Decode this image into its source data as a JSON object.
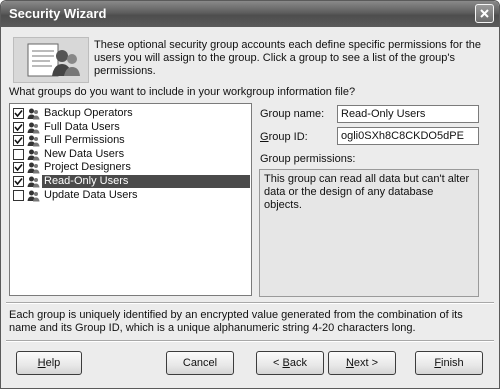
{
  "window": {
    "title": "Security Wizard"
  },
  "intro_text": "These optional security group accounts each define specific permissions for the users you will assign to the group. Click a group to see a list of the group's permissions.",
  "question": "What groups do you want to include in your workgroup information file?",
  "groups": [
    {
      "label": "Backup Operators",
      "checked": true,
      "selected": false
    },
    {
      "label": "Full Data Users",
      "checked": true,
      "selected": false
    },
    {
      "label": "Full Permissions",
      "checked": true,
      "selected": false
    },
    {
      "label": "New Data Users",
      "checked": false,
      "selected": false
    },
    {
      "label": "Project Designers",
      "checked": true,
      "selected": false
    },
    {
      "label": "Read-Only Users",
      "checked": true,
      "selected": true
    },
    {
      "label": "Update Data Users",
      "checked": false,
      "selected": false
    }
  ],
  "group_name": {
    "label": "Group name:",
    "value": "Read-Only Users"
  },
  "group_id": {
    "label_prefix": "G",
    "label_rest": "roup ID:",
    "value": "ogli0SXh8C8CKDO5dPE"
  },
  "permissions": {
    "label": "Group permissions:",
    "text": "This group can read all data but can't alter data or the design of any database objects."
  },
  "footer_text": "Each group is uniquely identified by an encrypted value generated from the combination of its name and its Group ID, which is a unique alphanumeric string 4-20 characters long.",
  "buttons": {
    "help": {
      "u": "H",
      "rest": "elp"
    },
    "cancel": "Cancel",
    "back": {
      "pre": "< ",
      "u": "B",
      "rest": "ack"
    },
    "next": {
      "u": "N",
      "rest": "ext >"
    },
    "finish": {
      "u": "F",
      "rest": "inish"
    }
  }
}
